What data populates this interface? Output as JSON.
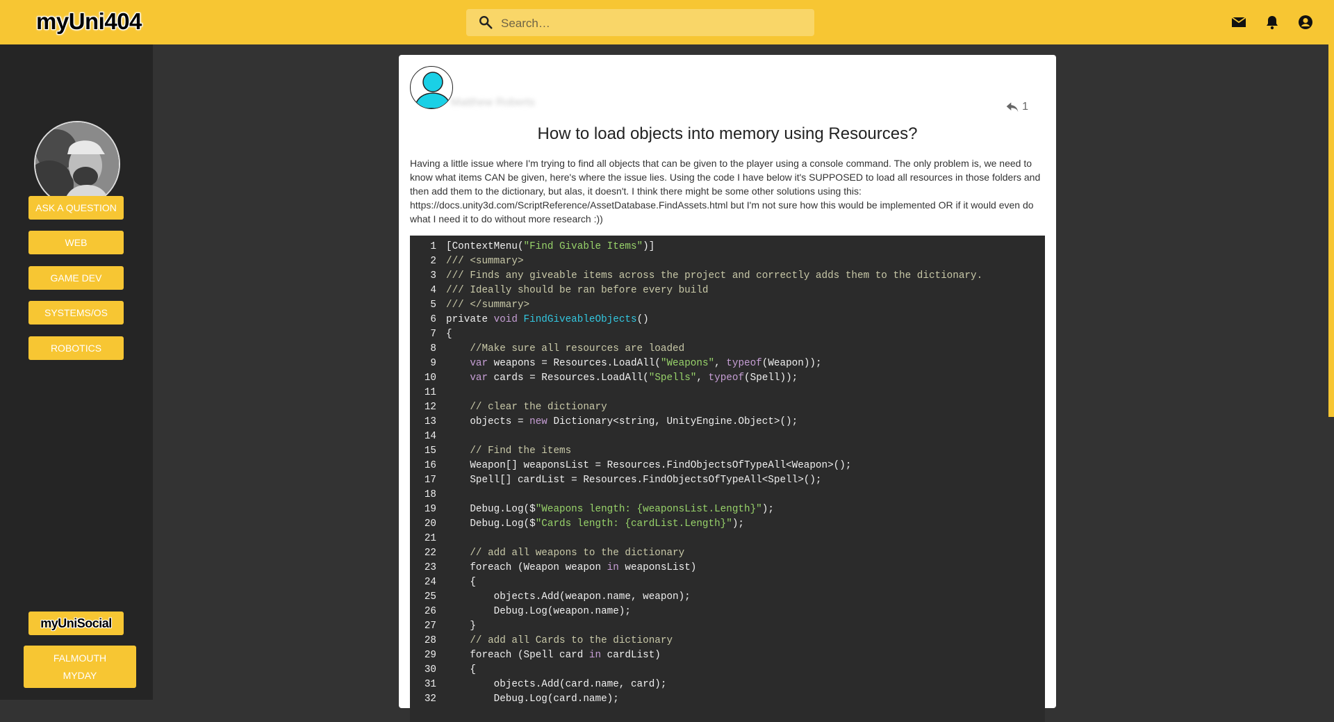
{
  "header": {
    "logo": "myUni404",
    "search_placeholder": "Search…",
    "icons": [
      "mail-icon",
      "bell-icon",
      "account-icon"
    ]
  },
  "sidebar": {
    "buttons": [
      {
        "label": "ASK A QUESTION"
      },
      {
        "label": "WEB"
      },
      {
        "label": "GAME DEV"
      },
      {
        "label": "SYSTEMS/OS"
      },
      {
        "label": "ROBOTICS"
      }
    ],
    "social_label": "myUniSocial",
    "myday_line1": "FALMOUTH",
    "myday_line2": "MYDAY"
  },
  "post": {
    "author": "Matthew Roberts",
    "reply_count": "1",
    "title": "How to load objects into memory using Resources?",
    "body": "Having a little issue where I'm trying to find all objects that can be given to the player using a console command. The only problem is, we need to know what items CAN be given, here's where the issue lies. Using the code I have below it's SUPPOSED to load all resources in those folders and then add them to the dictionary, but alas, it doesn't. I think there might be some other solutions using this: https://docs.unity3d.com/ScriptReference/AssetDatabase.FindAssets.html but I'm not sure how this would be implemented OR if it would even do what I need it to do without more research :))"
  },
  "code": [
    {
      "n": "1",
      "t": [
        [
          "p",
          "[ContextMenu("
        ],
        [
          "s",
          "\"Find Givable Items\""
        ],
        [
          "p",
          ")]"
        ]
      ]
    },
    {
      "n": "2",
      "t": [
        [
          "c",
          "/// <summary>"
        ]
      ]
    },
    {
      "n": "3",
      "t": [
        [
          "c",
          "/// Finds any giveable items across the project and correctly adds them to the dictionary."
        ]
      ]
    },
    {
      "n": "4",
      "t": [
        [
          "c",
          "/// Ideally should be ran before every build"
        ]
      ]
    },
    {
      "n": "5",
      "t": [
        [
          "c",
          "/// </summary>"
        ]
      ]
    },
    {
      "n": "6",
      "t": [
        [
          "p",
          "private "
        ],
        [
          "k",
          "void "
        ],
        [
          "f",
          "FindGiveableObjects"
        ],
        [
          "p",
          "()"
        ]
      ]
    },
    {
      "n": "7",
      "t": [
        [
          "p",
          "{"
        ]
      ]
    },
    {
      "n": "8",
      "t": [
        [
          "p",
          "    "
        ],
        [
          "c",
          "//Make sure all resources are loaded"
        ]
      ]
    },
    {
      "n": "9",
      "t": [
        [
          "p",
          "    "
        ],
        [
          "k",
          "var"
        ],
        [
          "p",
          " weapons = Resources.LoadAll("
        ],
        [
          "s",
          "\"Weapons\""
        ],
        [
          "p",
          ", "
        ],
        [
          "k",
          "typeof"
        ],
        [
          "p",
          "(Weapon));"
        ]
      ]
    },
    {
      "n": "10",
      "t": [
        [
          "p",
          "    "
        ],
        [
          "k",
          "var"
        ],
        [
          "p",
          " cards = Resources.LoadAll("
        ],
        [
          "s",
          "\"Spells\""
        ],
        [
          "p",
          ", "
        ],
        [
          "k",
          "typeof"
        ],
        [
          "p",
          "(Spell));"
        ]
      ]
    },
    {
      "n": "11",
      "t": [
        [
          "p",
          ""
        ]
      ]
    },
    {
      "n": "12",
      "t": [
        [
          "p",
          "    "
        ],
        [
          "c",
          "// clear the dictionary"
        ]
      ]
    },
    {
      "n": "13",
      "t": [
        [
          "p",
          "    objects = "
        ],
        [
          "k",
          "new"
        ],
        [
          "p",
          " Dictionary<string, UnityEngine.Object>();"
        ]
      ]
    },
    {
      "n": "14",
      "t": [
        [
          "p",
          ""
        ]
      ]
    },
    {
      "n": "15",
      "t": [
        [
          "p",
          "    "
        ],
        [
          "c",
          "// Find the items"
        ]
      ]
    },
    {
      "n": "16",
      "t": [
        [
          "p",
          "    Weapon[] weaponsList = Resources.FindObjectsOfTypeAll<Weapon>();"
        ]
      ]
    },
    {
      "n": "17",
      "t": [
        [
          "p",
          "    Spell[] cardList = Resources.FindObjectsOfTypeAll<Spell>();"
        ]
      ]
    },
    {
      "n": "18",
      "t": [
        [
          "p",
          ""
        ]
      ]
    },
    {
      "n": "19",
      "t": [
        [
          "p",
          "    Debug.Log($"
        ],
        [
          "s",
          "\"Weapons length: {weaponsList.Length}\""
        ],
        [
          "p",
          ");"
        ]
      ]
    },
    {
      "n": "20",
      "t": [
        [
          "p",
          "    Debug.Log($"
        ],
        [
          "s",
          "\"Cards length: {cardList.Length}\""
        ],
        [
          "p",
          ");"
        ]
      ]
    },
    {
      "n": "21",
      "t": [
        [
          "p",
          ""
        ]
      ]
    },
    {
      "n": "22",
      "t": [
        [
          "p",
          "    "
        ],
        [
          "c",
          "// add all weapons to the dictionary"
        ]
      ]
    },
    {
      "n": "23",
      "t": [
        [
          "p",
          "    foreach (Weapon weapon "
        ],
        [
          "k",
          "in"
        ],
        [
          "p",
          " weaponsList)"
        ]
      ]
    },
    {
      "n": "24",
      "t": [
        [
          "p",
          "    {"
        ]
      ]
    },
    {
      "n": "25",
      "t": [
        [
          "p",
          "        objects.Add(weapon.name, weapon);"
        ]
      ]
    },
    {
      "n": "26",
      "t": [
        [
          "p",
          "        Debug.Log(weapon.name);"
        ]
      ]
    },
    {
      "n": "27",
      "t": [
        [
          "p",
          "    }"
        ]
      ]
    },
    {
      "n": "28",
      "t": [
        [
          "p",
          "    "
        ],
        [
          "c",
          "// add all Cards to the dictionary"
        ]
      ]
    },
    {
      "n": "29",
      "t": [
        [
          "p",
          "    foreach (Spell card "
        ],
        [
          "k",
          "in"
        ],
        [
          "p",
          " cardList)"
        ]
      ]
    },
    {
      "n": "30",
      "t": [
        [
          "p",
          "    {"
        ]
      ]
    },
    {
      "n": "31",
      "t": [
        [
          "p",
          "        objects.Add(card.name, card);"
        ]
      ]
    },
    {
      "n": "32",
      "t": [
        [
          "p",
          "        Debug.Log(card.name);"
        ]
      ]
    }
  ],
  "colors": {
    "accent": "#f7c633",
    "sidebar": "#252525",
    "background": "#333333",
    "code_bg": "#2b2b2b"
  }
}
